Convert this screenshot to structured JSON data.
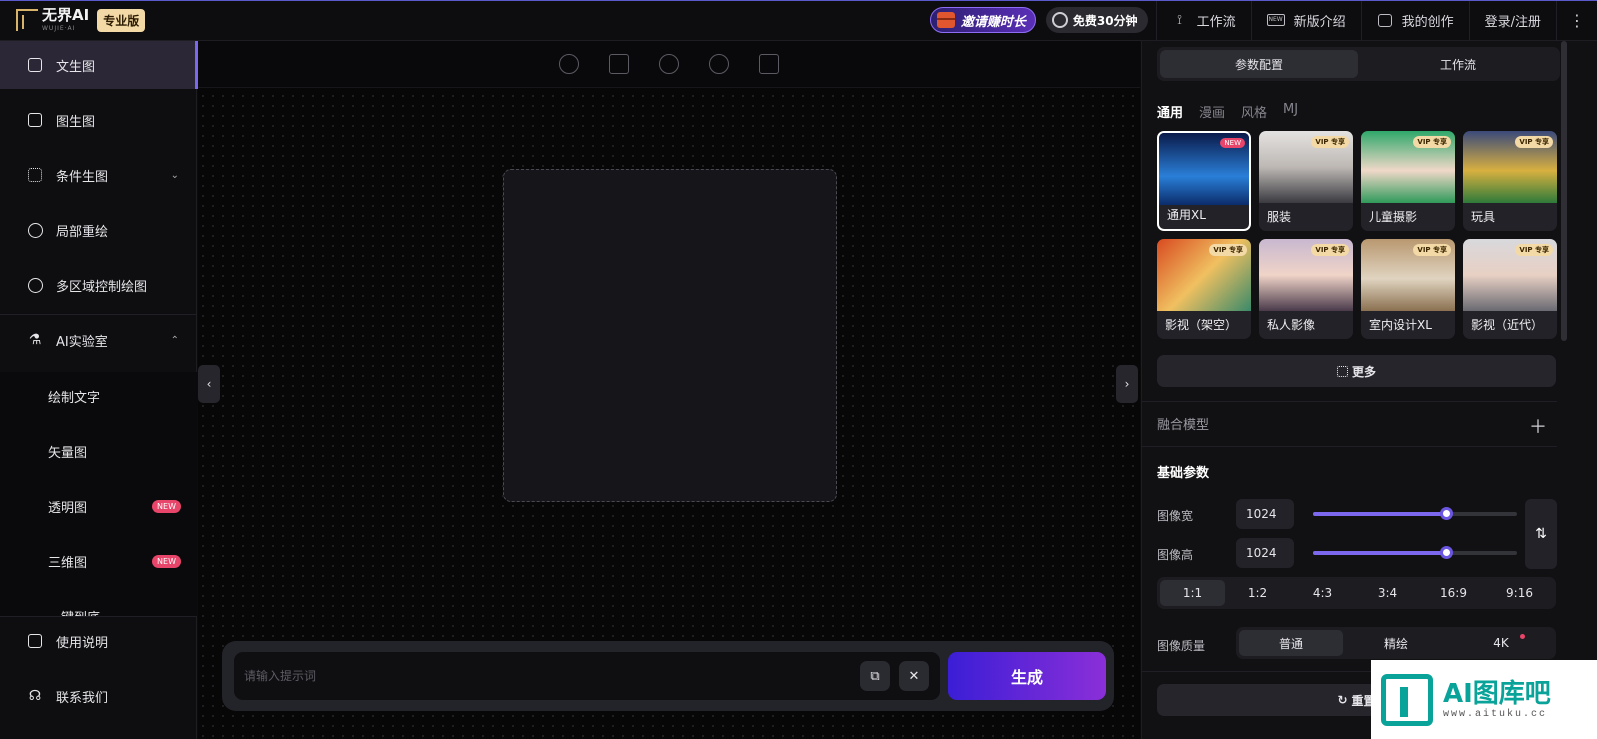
{
  "header": {
    "logo_text": "无界AI",
    "logo_sub": "WUJIE·AI",
    "edition_badge": "专业版",
    "invite_label": "邀请赚时长",
    "free_label": "免费30分钟",
    "nav": [
      {
        "label": "工作流",
        "icon": "workflow-icon"
      },
      {
        "label": "新版介绍",
        "icon": "new-badge-icon"
      },
      {
        "label": "我的创作",
        "icon": "image-icon"
      },
      {
        "label": "登录/注册",
        "icon": ""
      }
    ]
  },
  "sidebar": {
    "items": [
      {
        "label": "文生图",
        "icon": "image-icon",
        "active": true
      },
      {
        "label": "图生图",
        "icon": "images-icon"
      },
      {
        "label": "条件生图",
        "icon": "control-icon",
        "expand": "⌄"
      },
      {
        "label": "局部重绘",
        "icon": "repaint-icon"
      },
      {
        "label": "多区域控制绘图",
        "icon": "regions-icon"
      },
      {
        "label": "AI实验室",
        "icon": "flask-icon",
        "expand": "⌃"
      }
    ],
    "lab_items": [
      {
        "label": "绘制文字"
      },
      {
        "label": "矢量图"
      },
      {
        "label": "透明图",
        "badge": "NEW"
      },
      {
        "label": "三维图",
        "badge": "NEW"
      },
      {
        "label": "一键到底"
      }
    ],
    "footer": [
      {
        "label": "使用说明",
        "icon": "book-icon"
      },
      {
        "label": "联系我们",
        "icon": "headset-icon"
      }
    ]
  },
  "canvas": {
    "prompt_placeholder": "请输入提示词",
    "generate_label": "生成"
  },
  "panel": {
    "tabs": [
      {
        "label": "参数配置",
        "active": true
      },
      {
        "label": "工作流"
      }
    ],
    "categories": [
      {
        "label": "通用",
        "active": true
      },
      {
        "label": "漫画"
      },
      {
        "label": "风格"
      },
      {
        "label": "MJ"
      }
    ],
    "models": [
      {
        "label": "通用XL",
        "tag": "NEW",
        "selected": true
      },
      {
        "label": "服装",
        "tag": "VIP 专享"
      },
      {
        "label": "儿童摄影",
        "tag": "VIP 专享"
      },
      {
        "label": "玩具",
        "tag": "VIP 专享"
      },
      {
        "label": "影视（架空）",
        "tag": "VIP 专享"
      },
      {
        "label": "私人影像",
        "tag": "VIP 专享"
      },
      {
        "label": "室内设计XL",
        "tag": "VIP 专享"
      },
      {
        "label": "影视（近代）",
        "tag": "VIP 专享"
      }
    ],
    "more_label": "更多",
    "fusion_title": "融合模型",
    "basic_title": "基础参数",
    "width_label": "图像宽",
    "width_value": "1024",
    "height_label": "图像高",
    "height_value": "1024",
    "width_slider": 0.65,
    "height_slider": 0.65,
    "ratios": [
      {
        "label": "1:1",
        "active": true
      },
      {
        "label": "1:2"
      },
      {
        "label": "4:3"
      },
      {
        "label": "3:4"
      },
      {
        "label": "16:9"
      },
      {
        "label": "9:16"
      }
    ],
    "quality_label": "图像质量",
    "quality_options": [
      {
        "label": "普通",
        "active": true
      },
      {
        "label": "精绘"
      },
      {
        "label": "4K"
      }
    ],
    "reset_label": "重置"
  },
  "watermark": {
    "main": "AI图库吧",
    "sub": "www.aituku.cc"
  },
  "colors": {
    "accent": "#7b68ee",
    "generate_start": "#3b1ed6",
    "generate_end": "#8b2fd8",
    "vip_gold": "#f3d9a5",
    "new_pink": "#e8456a"
  }
}
